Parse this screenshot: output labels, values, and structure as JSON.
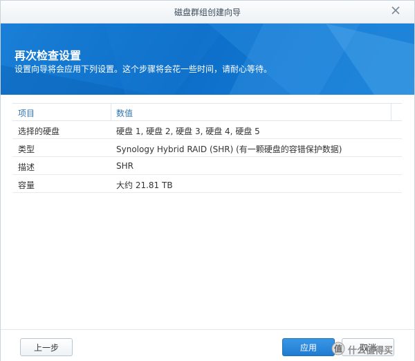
{
  "window": {
    "title": "磁盘群组创建向导"
  },
  "banner": {
    "heading": "再次检查设置",
    "subtitle": "设置向导将会应用下列设置。这个步骤将会花一些时间，请耐心等待。"
  },
  "table": {
    "headers": [
      "项目",
      "数值"
    ],
    "rows": [
      {
        "key": "选择的硬盘",
        "value": "硬盘 1, 硬盘 2, 硬盘 3, 硬盘 4, 硬盘 5"
      },
      {
        "key": "类型",
        "value": "Synology Hybrid RAID (SHR) (有一颗硬盘的容错保护数据)"
      },
      {
        "key": "描述",
        "value": "SHR"
      },
      {
        "key": "容量",
        "value": "大约 21.81 TB"
      }
    ]
  },
  "footer": {
    "prev_label": "上一步",
    "apply_label": "应用",
    "cancel_label": "取消"
  },
  "watermark": {
    "text": "什么值得买"
  },
  "colors": {
    "banner": "#0d6ec8",
    "header_text": "#2f74b5",
    "apply_button": "#1f7bd1"
  }
}
